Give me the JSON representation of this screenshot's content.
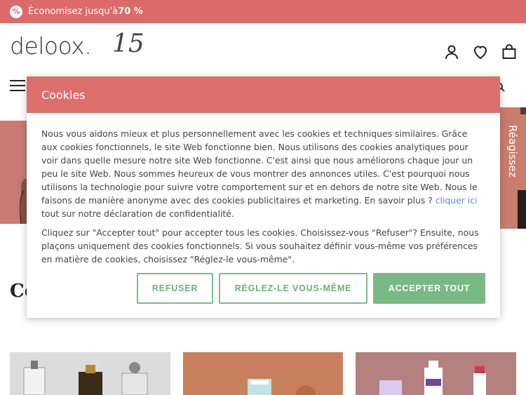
{
  "promo": {
    "badge": "%",
    "text_prefix": "Économisez jusqu'à",
    "text_bold": "70 %"
  },
  "header": {
    "logo": "deloox.",
    "logo_number": "15"
  },
  "hero": {
    "right_text": "Réagissez"
  },
  "section": {
    "heading_partial": "Co"
  },
  "cookie_modal": {
    "title": "Cookies",
    "paragraph1_before_link": "Nous vous aidons mieux et plus personnellement avec les cookies et techniques similaires. Grâce aux cookies fonctionnels, le site Web fonctionne bien. Nous utilisons des cookies analytiques pour voir dans quelle mesure notre site Web fonctionne. C'est ainsi que nous améliorons chaque jour un peu le site Web. Nous sommes heureux de vous montrer des annonces utiles. C'est pourquoi nous utilisons la technologie pour suivre votre comportement sur et en dehors de notre site Web. Nous le faisons de manière anonyme avec des cookies publicitaires et marketing. En savoir plus ? ",
    "link_text": "cliquer ici",
    "paragraph1_after_link": " tout sur notre déclaration de confidentialité.",
    "paragraph2": "Cliquez sur \"Accepter tout\" pour accepter tous les cookies. Choisissez-vous \"Refuser\"? Ensuite, nous plaçons uniquement des cookies fonctionnels. Si vous souhaitez définir vous-même vos préférences en matière de cookies, choisissez \"Réglez-le vous-même\".",
    "buttons": {
      "refuse": "REFUSER",
      "customize": "RÉGLEZ-LE VOUS-MÊME",
      "accept": "ACCEPTER TOUT"
    }
  },
  "colors": {
    "brand": "#dc6e6c",
    "accept_green": "#78b985",
    "link": "#5b8fc5"
  }
}
